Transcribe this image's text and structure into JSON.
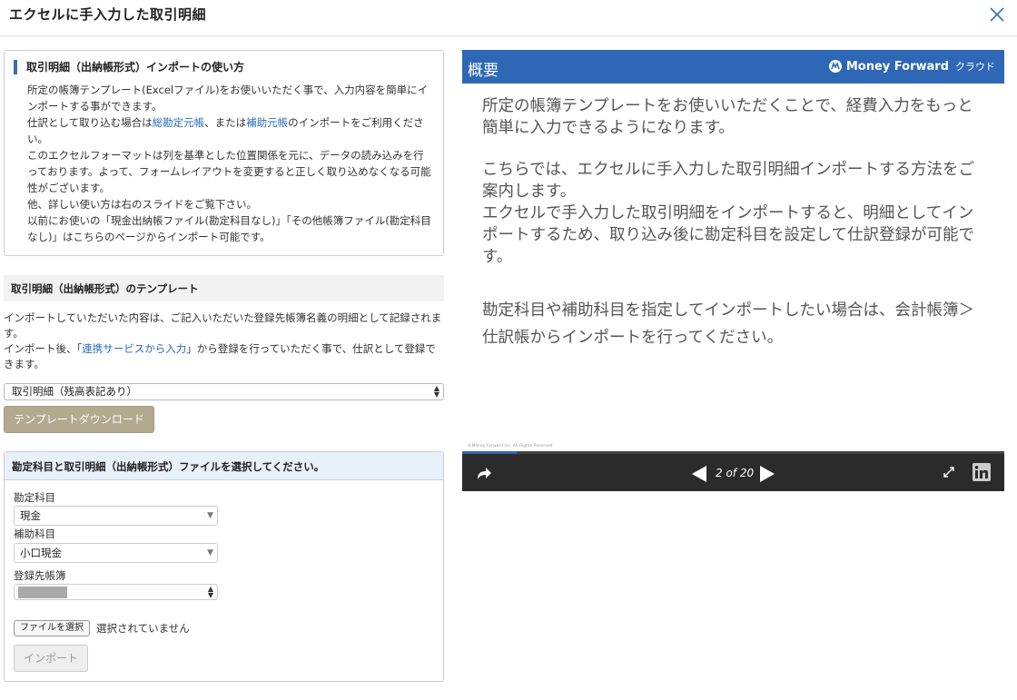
{
  "modal": {
    "title": "エクセルに手入力した取引明細"
  },
  "guide": {
    "title": "取引明細（出納帳形式）インポートの使い方",
    "line1": "所定の帳簿テンプレート(Excelファイル)をお使いいただく事で、入力内容を簡単にインポートする事ができます。",
    "line2_pre": "仕訳として取り込む場合は",
    "link1": "総勘定元帳",
    "line2_mid": "、または",
    "link2": "補助元帳",
    "line2_post": "のインポートをご利用ください。",
    "line3": "このエクセルフォーマットは列を基準とした位置関係を元に、データの読み込みを行っております。よって、フォームレイアウトを変更すると正しく取り込めなくなる可能性がございます。",
    "line4": "他、詳しい使い方は右のスライドをご覧下さい。",
    "line5": "以前にお使いの「現金出納帳ファイル(勘定科目なし)」「その他帳簿ファイル(勘定科目なし)」はこちらのページからインポート可能です。"
  },
  "template": {
    "heading": "取引明細（出納帳形式）のテンプレート",
    "desc1": "インポートしていただいた内容は、ご記入いただいた登録先帳簿名義の明細として記録されます。",
    "desc2_pre": "インポート後、「",
    "desc2_link": "連携サービスから入力",
    "desc2_post": "」から登録を行っていただく事で、仕訳として登録できます。",
    "select_value": "取引明細（残高表記あり）",
    "download_label": "テンプレートダウンロード"
  },
  "file_form": {
    "heading": "勘定科目と取引明細（出納帳形式）ファイルを選択してください。",
    "account_label": "勘定科目",
    "account_value": "現金",
    "sub_account_label": "補助科目",
    "sub_account_value": "小口現金",
    "ledger_label": "登録先帳簿",
    "file_button": "ファイルを選択",
    "file_status": "選択されていません",
    "import_label": "インポート"
  },
  "slide": {
    "title": "概要",
    "brand": "Money Forward",
    "brand_suffix": "クラウド",
    "p1": "所定の帳簿テンプレートをお使いいただくことで、経費入力をもっと簡単に入力できるようになります。",
    "p2": "こちらでは、エクセルに手入力した取引明細インポートする方法をご案内します。",
    "p3": "エクセルで手入力した取引明細をインポートすると、明細としてインポートするため、取り込み後に勘定科目を設定して仕訳登録が可能です。",
    "p4": "勘定科目や補助科目を指定してインポートしたい場合は、会計帳簿＞仕訳帳からインポートを行ってください。",
    "copyright": "©Money Forward Inc. All Rights Reserved",
    "page_indicator": "2 of 20",
    "progress": 0.1
  },
  "colors": {
    "primary": "#2e67b6",
    "download_btn": "#b3a98f",
    "link": "#2a6cbd"
  }
}
